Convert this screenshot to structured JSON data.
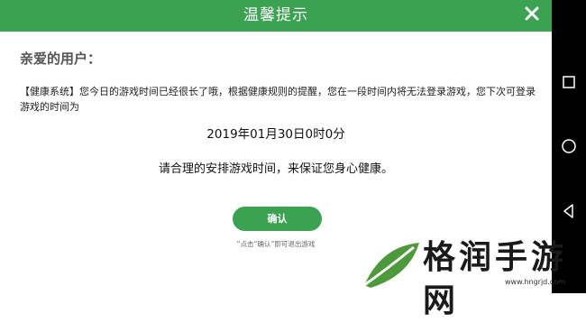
{
  "dialog": {
    "title": "温馨提示",
    "greeting": "亲爱的用户：",
    "message": "【健康系统】您今日的游戏时间已经很长了哦，根据健康规则的提醒，您在一段时间内将无法登录游戏，您下次可登录游戏的时间为",
    "datetime": "2019年01月30日0时0分",
    "advice": "请合理的安排游戏时间，来保证您身心健康。",
    "confirm_label": "确认",
    "hint": "“点击“确认”即可退出游戏"
  },
  "watermark": {
    "text": "格润手游网",
    "url": "www.hngrjd.com"
  },
  "colors": {
    "accent": "#3aa251",
    "navbar": "#000000"
  },
  "icons": [
    "close-icon",
    "square-icon",
    "circle-icon",
    "triangle-icon",
    "leaf-logo-icon"
  ]
}
